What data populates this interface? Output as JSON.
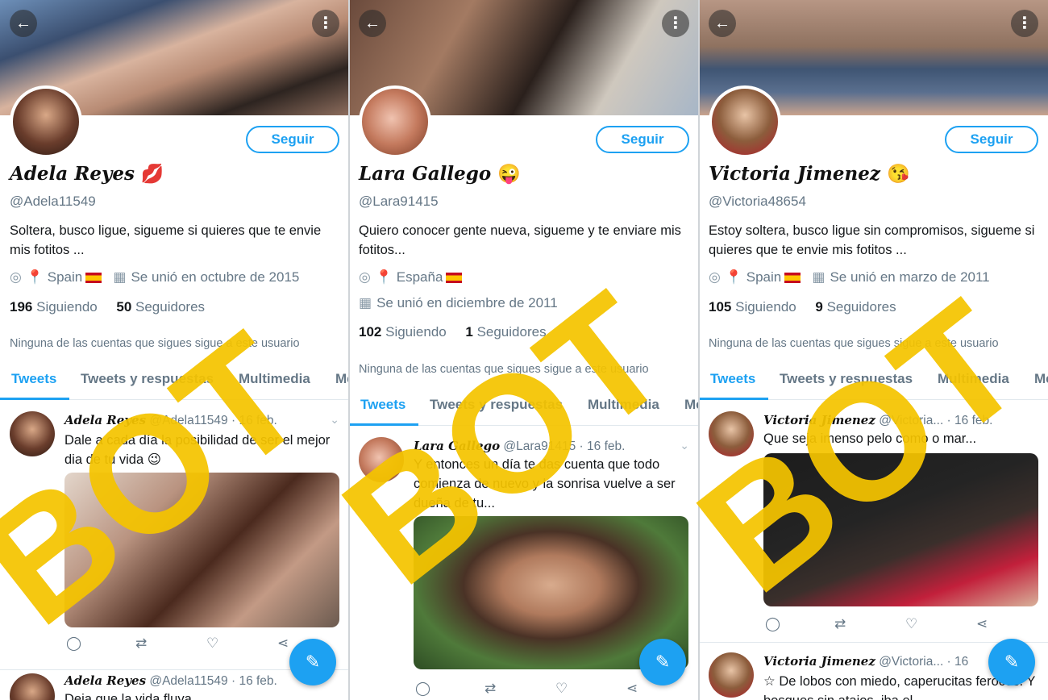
{
  "profiles": [
    {
      "display_name": "Adela Reyes",
      "handle": "@Adela11549",
      "follow_label": "Seguir",
      "bio": "Soltera, busco ligue, sigueme si quieres que te envie mis fotitos  ...",
      "location": "Spain",
      "joined": "Se unió en octubre de 2015",
      "following_count": "196",
      "following_label": "Siguiendo",
      "followers_count": "50",
      "followers_label": "Seguidores",
      "notice": "Ninguna de las cuentas que sigues sigue a este usuario",
      "tabs": [
        "Tweets",
        "Tweets y respuestas",
        "Multimedia",
        "Me gusta"
      ],
      "tweet": {
        "author": "Adela Reyes",
        "handle_date": "@Adela11549 · 16 feb.",
        "text": "Dale a cada día la posibilidad de ser el mejor dia de tu vida 😉"
      },
      "tweet2": {
        "author": "Adela Reyes",
        "handle_date": "@Adela11549 · 16 feb.",
        "text": "Deja que la vida fluya..."
      }
    },
    {
      "display_name": "Lara Gallego",
      "handle": "@Lara91415",
      "follow_label": "Seguir",
      "bio": "Quiero conocer gente nueva, sigueme y te enviare mis fotitos...",
      "location": "España",
      "joined": "Se unió en diciembre de 2011",
      "following_count": "102",
      "following_label": "Siguiendo",
      "followers_count": "1",
      "followers_label": "Seguidores",
      "notice": "Ninguna de las cuentas que sigues sigue a este usuario",
      "tabs": [
        "Tweets",
        "Tweets y respuestas",
        "Multimedia",
        "Me gusta"
      ],
      "tweet": {
        "author": "Lara Gallego",
        "handle_date": "@Lara91415 · 16 feb.",
        "text": "Y entonces un día te das cuenta que todo comienza de nuevo y la sonrisa vuelve a ser dueña de tu..."
      }
    },
    {
      "display_name": "Victoria Jimenez",
      "handle": "@Victoria48654",
      "follow_label": "Seguir",
      "bio": "Estoy soltera, busco ligue sin compromisos, sigueme si quieres que te envie mis fotitos ...",
      "location": "Spain",
      "joined": "Se unió en marzo de 2011",
      "following_count": "105",
      "following_label": "Siguiendo",
      "followers_count": "9",
      "followers_label": "Seguidores",
      "notice": "Ninguna de las cuentas que sigues sigue a este usuario",
      "tabs": [
        "Tweets",
        "Tweets y respuestas",
        "Multimedia",
        "Me gusta"
      ],
      "tweet": {
        "author": "Victoria Jimenez",
        "handle_date": "@Victoria... · 16 feb.",
        "text": "Que seja imenso pelo como o mar..."
      },
      "tweet2": {
        "author": "Victoria Jimenez",
        "handle_date": "@Victoria... · 16",
        "text": "☆ De lobos con miedo,  caperucitas feroces. Y bosques sin atajos, iba el..."
      }
    }
  ],
  "overlay_text": "BOT",
  "overlay_color": "#f5c400",
  "accent_color": "#1da1f2",
  "icons": [
    "back-arrow-icon",
    "more-icon",
    "location-icon",
    "pin-icon",
    "spain-flag-icon",
    "calendar-icon",
    "reply-icon",
    "retweet-icon",
    "like-icon",
    "share-icon",
    "compose-icon",
    "chevron-down-icon"
  ]
}
